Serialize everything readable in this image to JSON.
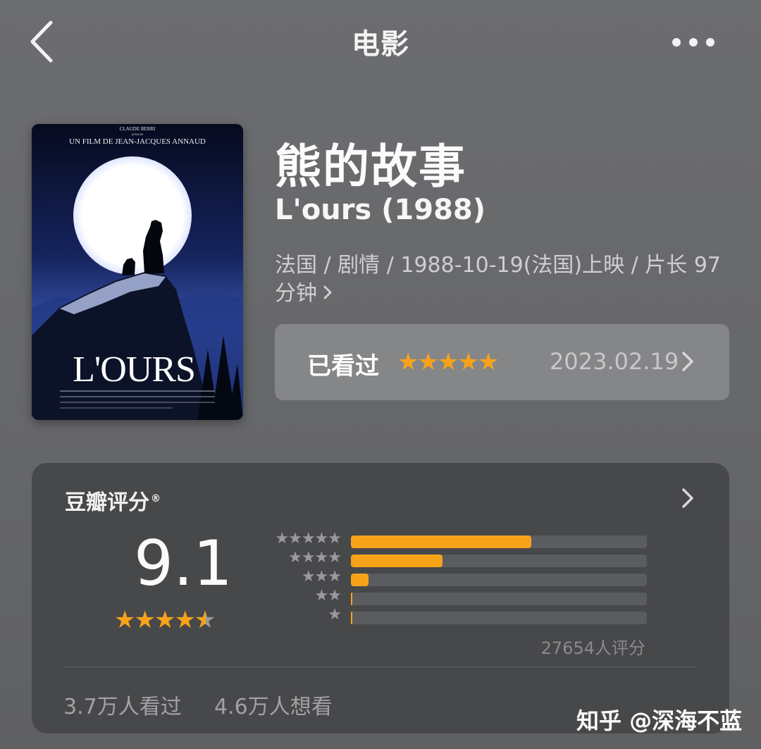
{
  "header": {
    "title": "电影"
  },
  "movie": {
    "title_cn": "熊的故事",
    "title_en": "L'ours (1988)",
    "meta": "法国 / 剧情 / 1988-10-19(法国)上映 / 片长 97分钟",
    "poster": {
      "presenter": "CLAUDE BERRI",
      "presents": "présente",
      "director_line": "UN FILM DE JEAN-JACQUES ANNAUD",
      "title": "L'OURS"
    }
  },
  "watched": {
    "label": "已看过",
    "stars": "★★★★★",
    "date": "2023.02.19"
  },
  "rating": {
    "title": "豆瓣评分",
    "trademark": "®",
    "score": "9.1",
    "stars_value": 4.5,
    "distribution": [
      {
        "stars": "★★★★★",
        "fraction": 0.61
      },
      {
        "stars": "★★★★",
        "fraction": 0.31
      },
      {
        "stars": "★★★",
        "fraction": 0.06
      },
      {
        "stars": "★★",
        "fraction": 0.005
      },
      {
        "stars": "★",
        "fraction": 0.004
      }
    ],
    "count": "27654人评分",
    "watched_count": "3.7万人看过",
    "want_count": "4.6万人想看"
  },
  "watermark": "知乎 @深海不蓝",
  "colors": {
    "accent": "#f6a31a",
    "card": "#47484a",
    "watched_card": "#858688"
  },
  "icons": {
    "back": "chevron-left-icon",
    "more": "more-dots-icon",
    "chevron": "chevron-right-icon"
  }
}
